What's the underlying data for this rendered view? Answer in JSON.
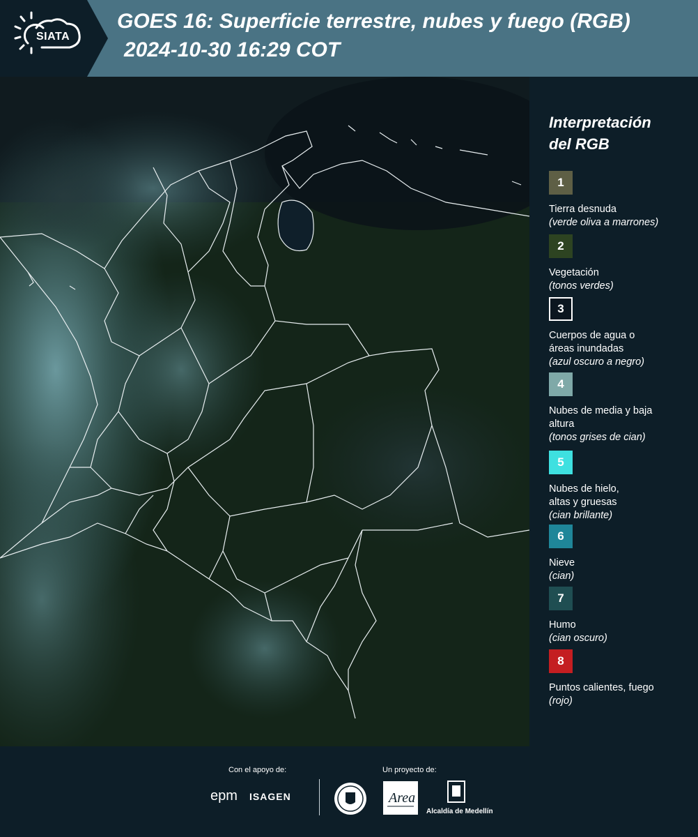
{
  "header": {
    "logo_text": "SIATA",
    "title_line1": "GOES 16: Superficie terrestre, nubes y fuego (RGB)",
    "title_line2": "2024-10-30 16:29 COT"
  },
  "map": {
    "description_icon": "satellite-map-image"
  },
  "legend": {
    "title_line1": "Interpretación",
    "title_line2": "del RGB",
    "items": [
      {
        "number": "1",
        "label": "Tierra desnuda",
        "sub": "(verde oliva a marrones)",
        "color": "#5e5f45"
      },
      {
        "number": "2",
        "label": "Vegetación",
        "sub": "(tonos verdes)",
        "color": "#2d4321"
      },
      {
        "number": "3",
        "label": "Cuerpos de agua o áreas inundadas",
        "sub": "(azul oscuro a negro)",
        "color": "#0b161f"
      },
      {
        "number": "4",
        "label": "Nubes de media y baja altura",
        "sub": "(tonos grises de cian)",
        "color": "#7fa9a8"
      },
      {
        "number": "5",
        "label": "Nubes de hielo, altas y gruesas",
        "sub": "(cian brillante)",
        "color": "#3ee0e0"
      },
      {
        "number": "6",
        "label": "Nieve",
        "sub": "(cian)",
        "color": "#1f8699"
      },
      {
        "number": "7",
        "label": "Humo",
        "sub": "(cian oscuro)",
        "color": "#1f4e52"
      },
      {
        "number": "8",
        "label": "Puntos calientes, fuego",
        "sub": "(rojo)",
        "color": "#c41e21"
      }
    ]
  },
  "footer": {
    "support_caption": "Con el apoyo de:",
    "project_caption": "Un proyecto de:",
    "epm": "epm",
    "isagen": "ISAGEN",
    "alcaldia": "Alcaldía de Medellín"
  }
}
